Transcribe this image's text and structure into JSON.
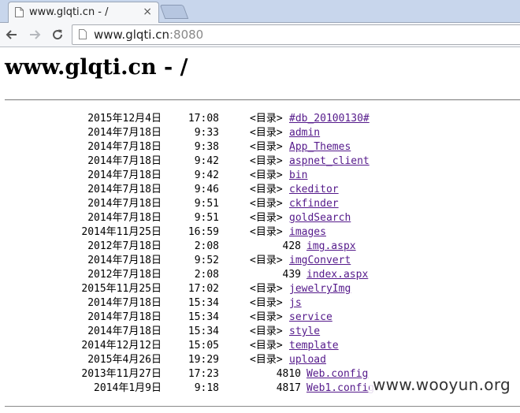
{
  "browser": {
    "tab_title": "www.glqti.cn - /",
    "tab_close": "×",
    "url_host": "www.glqti.cn",
    "url_port": ":8080"
  },
  "page": {
    "heading": "www.glqti.cn - /",
    "dir_label": "<目录>",
    "entries": [
      {
        "date": "2015年12月4日",
        "time": "17:08",
        "size": "<目录>",
        "name": "#db_20100130#",
        "is_dir": true
      },
      {
        "date": "2014年7月18日",
        "time": "9:33",
        "size": "<目录>",
        "name": "admin",
        "is_dir": true
      },
      {
        "date": "2014年7月18日",
        "time": "9:38",
        "size": "<目录>",
        "name": "App_Themes",
        "is_dir": true
      },
      {
        "date": "2014年7月18日",
        "time": "9:42",
        "size": "<目录>",
        "name": "aspnet_client",
        "is_dir": true
      },
      {
        "date": "2014年7月18日",
        "time": "9:42",
        "size": "<目录>",
        "name": "bin",
        "is_dir": true
      },
      {
        "date": "2014年7月18日",
        "time": "9:46",
        "size": "<目录>",
        "name": "ckeditor",
        "is_dir": true
      },
      {
        "date": "2014年7月18日",
        "time": "9:51",
        "size": "<目录>",
        "name": "ckfinder",
        "is_dir": true
      },
      {
        "date": "2014年7月18日",
        "time": "9:51",
        "size": "<目录>",
        "name": "goldSearch",
        "is_dir": true
      },
      {
        "date": "2014年11月25日",
        "time": "16:59",
        "size": "<目录>",
        "name": "images",
        "is_dir": true
      },
      {
        "date": "2012年7月18日",
        "time": "2:08",
        "size": "428",
        "name": "img.aspx",
        "is_dir": false
      },
      {
        "date": "2014年7月18日",
        "time": "9:52",
        "size": "<目录>",
        "name": "imgConvert",
        "is_dir": true
      },
      {
        "date": "2012年7月18日",
        "time": "2:08",
        "size": "439",
        "name": "index.aspx",
        "is_dir": false
      },
      {
        "date": "2015年11月25日",
        "time": "17:02",
        "size": "<目录>",
        "name": "jewelryImg",
        "is_dir": true
      },
      {
        "date": "2014年7月18日",
        "time": "15:34",
        "size": "<目录>",
        "name": "js",
        "is_dir": true
      },
      {
        "date": "2014年7月18日",
        "time": "15:34",
        "size": "<目录>",
        "name": "service",
        "is_dir": true
      },
      {
        "date": "2014年7月18日",
        "time": "15:34",
        "size": "<目录>",
        "name": "style",
        "is_dir": true
      },
      {
        "date": "2014年12月12日",
        "time": "15:05",
        "size": "<目录>",
        "name": "template",
        "is_dir": true
      },
      {
        "date": "2015年4月26日",
        "time": "19:29",
        "size": "<目录>",
        "name": "upload",
        "is_dir": true
      },
      {
        "date": "2013年11月27日",
        "time": "17:23",
        "size": "4810",
        "name": "Web.config",
        "is_dir": false
      },
      {
        "date": "2014年1月9日",
        "time": "9:18",
        "size": "4817",
        "name": "Web1.config",
        "is_dir": false
      }
    ]
  },
  "watermark": "www.wooyun.org",
  "colors": {
    "link_visited": "#551a8b",
    "tabstrip": "#c8d6ec"
  }
}
